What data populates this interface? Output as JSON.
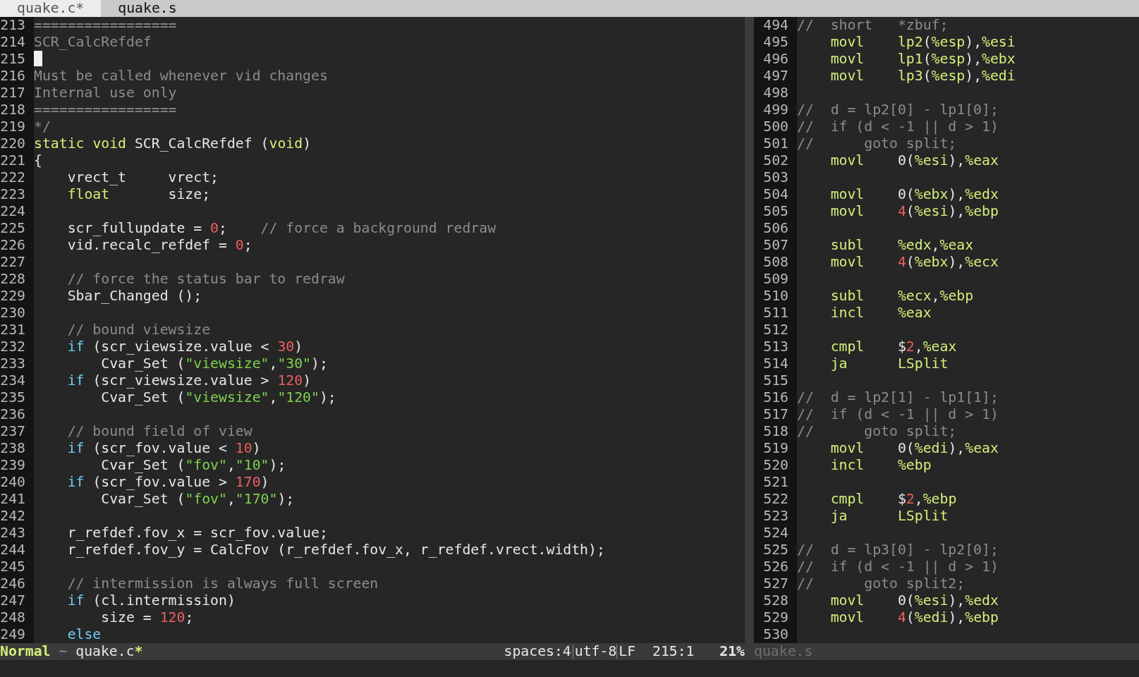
{
  "tabs": [
    {
      "label": "quake.c*",
      "selected": true
    },
    {
      "label": "quake.s",
      "selected": false
    }
  ],
  "panes": [
    {
      "lines": [
        {
          "number": "213",
          "cursor": false,
          "tokens": [
            {
              "kind": "comment",
              "text": "================="
            }
          ]
        },
        {
          "number": "214",
          "cursor": false,
          "tokens": [
            {
              "kind": "comment",
              "text": "SCR_CalcRefdef"
            }
          ]
        },
        {
          "number": "215",
          "cursor": true
        },
        {
          "number": "216",
          "cursor": false,
          "tokens": [
            {
              "kind": "comment",
              "text": "Must be called whenever vid changes"
            }
          ]
        },
        {
          "number": "217",
          "cursor": false,
          "tokens": [
            {
              "kind": "comment",
              "text": "Internal use only"
            }
          ]
        },
        {
          "number": "218",
          "cursor": false,
          "tokens": [
            {
              "kind": "comment",
              "text": "================="
            }
          ]
        },
        {
          "number": "219",
          "cursor": false,
          "tokens": [
            {
              "kind": "comment",
              "text": "*/"
            }
          ]
        },
        {
          "number": "220",
          "cursor": false,
          "tokens": [
            {
              "kind": "type",
              "text": "static"
            },
            {
              "kind": "type",
              "text": " void"
            },
            {
              "kind": "plain",
              "text": " SCR_CalcRefdef ("
            },
            {
              "kind": "type",
              "text": "void"
            },
            {
              "kind": "plain",
              "text": ")"
            }
          ]
        },
        {
          "number": "221",
          "cursor": false,
          "tokens": [
            {
              "kind": "plain",
              "text": "{"
            }
          ]
        },
        {
          "number": "222",
          "cursor": false,
          "tokens": [
            {
              "kind": "plain",
              "text": "    vrect_t     vrect;"
            }
          ]
        },
        {
          "number": "223",
          "cursor": false,
          "tokens": [
            {
              "kind": "type",
              "text": "    float"
            },
            {
              "kind": "plain",
              "text": "       size;"
            }
          ]
        },
        {
          "number": "224",
          "cursor": false
        },
        {
          "number": "225",
          "cursor": false,
          "tokens": [
            {
              "kind": "plain",
              "text": "    scr_fullupdate = "
            },
            {
              "kind": "number",
              "text": "0"
            },
            {
              "kind": "plain",
              "text": ";"
            },
            {
              "kind": "comment",
              "text": "    // force a background redraw"
            }
          ]
        },
        {
          "number": "226",
          "cursor": false,
          "tokens": [
            {
              "kind": "plain",
              "text": "    vid.recalc_refdef = "
            },
            {
              "kind": "number",
              "text": "0"
            },
            {
              "kind": "plain",
              "text": ";"
            }
          ]
        },
        {
          "number": "227",
          "cursor": false
        },
        {
          "number": "228",
          "cursor": false,
          "tokens": [
            {
              "kind": "comment",
              "text": "    // force the status bar to redraw"
            }
          ]
        },
        {
          "number": "229",
          "cursor": false,
          "tokens": [
            {
              "kind": "plain",
              "text": "    Sbar_Changed ();"
            }
          ]
        },
        {
          "number": "230",
          "cursor": false
        },
        {
          "number": "231",
          "cursor": false,
          "tokens": [
            {
              "kind": "comment",
              "text": "    // bound viewsize"
            }
          ]
        },
        {
          "number": "232",
          "cursor": false,
          "tokens": [
            {
              "kind": "keyword",
              "text": "    if"
            },
            {
              "kind": "plain",
              "text": " (scr_viewsize.value < "
            },
            {
              "kind": "number",
              "text": "30"
            },
            {
              "kind": "plain",
              "text": ")"
            }
          ]
        },
        {
          "number": "233",
          "cursor": false,
          "tokens": [
            {
              "kind": "plain",
              "text": "        Cvar_Set ("
            },
            {
              "kind": "string",
              "text": "\"viewsize\""
            },
            {
              "kind": "plain",
              "text": ","
            },
            {
              "kind": "string",
              "text": "\"30\""
            },
            {
              "kind": "plain",
              "text": ");"
            }
          ]
        },
        {
          "number": "234",
          "cursor": false,
          "tokens": [
            {
              "kind": "keyword",
              "text": "    if"
            },
            {
              "kind": "plain",
              "text": " (scr_viewsize.value > "
            },
            {
              "kind": "number",
              "text": "120"
            },
            {
              "kind": "plain",
              "text": ")"
            }
          ]
        },
        {
          "number": "235",
          "cursor": false,
          "tokens": [
            {
              "kind": "plain",
              "text": "        Cvar_Set ("
            },
            {
              "kind": "string",
              "text": "\"viewsize\""
            },
            {
              "kind": "plain",
              "text": ","
            },
            {
              "kind": "string",
              "text": "\"120\""
            },
            {
              "kind": "plain",
              "text": ");"
            }
          ]
        },
        {
          "number": "236",
          "cursor": false
        },
        {
          "number": "237",
          "cursor": false,
          "tokens": [
            {
              "kind": "comment",
              "text": "    // bound field of view"
            }
          ]
        },
        {
          "number": "238",
          "cursor": false,
          "tokens": [
            {
              "kind": "keyword",
              "text": "    if"
            },
            {
              "kind": "plain",
              "text": " (scr_fov.value < "
            },
            {
              "kind": "number",
              "text": "10"
            },
            {
              "kind": "plain",
              "text": ")"
            }
          ]
        },
        {
          "number": "239",
          "cursor": false,
          "tokens": [
            {
              "kind": "plain",
              "text": "        Cvar_Set ("
            },
            {
              "kind": "string",
              "text": "\"fov\""
            },
            {
              "kind": "plain",
              "text": ","
            },
            {
              "kind": "string",
              "text": "\"10\""
            },
            {
              "kind": "plain",
              "text": ");"
            }
          ]
        },
        {
          "number": "240",
          "cursor": false,
          "tokens": [
            {
              "kind": "keyword",
              "text": "    if"
            },
            {
              "kind": "plain",
              "text": " (scr_fov.value > "
            },
            {
              "kind": "number",
              "text": "170"
            },
            {
              "kind": "plain",
              "text": ")"
            }
          ]
        },
        {
          "number": "241",
          "cursor": false,
          "tokens": [
            {
              "kind": "plain",
              "text": "        Cvar_Set ("
            },
            {
              "kind": "string",
              "text": "\"fov\""
            },
            {
              "kind": "plain",
              "text": ","
            },
            {
              "kind": "string",
              "text": "\"170\""
            },
            {
              "kind": "plain",
              "text": ");"
            }
          ]
        },
        {
          "number": "242",
          "cursor": false
        },
        {
          "number": "243",
          "cursor": false,
          "tokens": [
            {
              "kind": "plain",
              "text": "    r_refdef.fov_x = scr_fov.value;"
            }
          ]
        },
        {
          "number": "244",
          "cursor": false,
          "tokens": [
            {
              "kind": "plain",
              "text": "    r_refdef.fov_y = CalcFov (r_refdef.fov_x, r_refdef.vrect.width);"
            }
          ]
        },
        {
          "number": "245",
          "cursor": false
        },
        {
          "number": "246",
          "cursor": false,
          "tokens": [
            {
              "kind": "comment",
              "text": "    // intermission is always full screen"
            }
          ]
        },
        {
          "number": "247",
          "cursor": false,
          "tokens": [
            {
              "kind": "keyword",
              "text": "    if"
            },
            {
              "kind": "plain",
              "text": " (cl.intermission)"
            }
          ]
        },
        {
          "number": "248",
          "cursor": false,
          "tokens": [
            {
              "kind": "plain",
              "text": "        size = "
            },
            {
              "kind": "number",
              "text": "120"
            },
            {
              "kind": "plain",
              "text": ";"
            }
          ]
        },
        {
          "number": "249",
          "cursor": false,
          "tokens": [
            {
              "kind": "keyword",
              "text": "    else"
            }
          ]
        }
      ]
    },
    {
      "lines": [
        {
          "number": "494",
          "cursor": false,
          "tokens": [
            {
              "kind": "comment",
              "text": "//  short   *zbuf;"
            }
          ]
        },
        {
          "number": "495",
          "cursor": false,
          "tokens": [
            {
              "kind": "type",
              "text": "    movl"
            },
            {
              "kind": "type",
              "text": "    lp2"
            },
            {
              "kind": "plain",
              "text": "("
            },
            {
              "kind": "type",
              "text": "%esp"
            },
            {
              "kind": "plain",
              "text": "),"
            },
            {
              "kind": "type",
              "text": "%esi"
            }
          ]
        },
        {
          "number": "496",
          "cursor": false,
          "tokens": [
            {
              "kind": "type",
              "text": "    movl"
            },
            {
              "kind": "type",
              "text": "    lp1"
            },
            {
              "kind": "plain",
              "text": "("
            },
            {
              "kind": "type",
              "text": "%esp"
            },
            {
              "kind": "plain",
              "text": "),"
            },
            {
              "kind": "type",
              "text": "%ebx"
            }
          ]
        },
        {
          "number": "497",
          "cursor": false,
          "tokens": [
            {
              "kind": "type",
              "text": "    movl"
            },
            {
              "kind": "type",
              "text": "    lp3"
            },
            {
              "kind": "plain",
              "text": "("
            },
            {
              "kind": "type",
              "text": "%esp"
            },
            {
              "kind": "plain",
              "text": "),"
            },
            {
              "kind": "type",
              "text": "%edi"
            }
          ]
        },
        {
          "number": "498",
          "cursor": false
        },
        {
          "number": "499",
          "cursor": false,
          "tokens": [
            {
              "kind": "comment",
              "text": "//  d = lp2[0] - lp1[0];"
            }
          ]
        },
        {
          "number": "500",
          "cursor": false,
          "tokens": [
            {
              "kind": "comment",
              "text": "//  if (d < -1 || d > 1)"
            }
          ]
        },
        {
          "number": "501",
          "cursor": false,
          "tokens": [
            {
              "kind": "comment",
              "text": "//      goto split;"
            }
          ]
        },
        {
          "number": "502",
          "cursor": false,
          "tokens": [
            {
              "kind": "type",
              "text": "    movl"
            },
            {
              "kind": "plain",
              "text": "    0("
            },
            {
              "kind": "type",
              "text": "%esi"
            },
            {
              "kind": "plain",
              "text": "),"
            },
            {
              "kind": "type",
              "text": "%eax"
            }
          ]
        },
        {
          "number": "503",
          "cursor": false
        },
        {
          "number": "504",
          "cursor": false,
          "tokens": [
            {
              "kind": "type",
              "text": "    movl"
            },
            {
              "kind": "plain",
              "text": "    0("
            },
            {
              "kind": "type",
              "text": "%ebx"
            },
            {
              "kind": "plain",
              "text": "),"
            },
            {
              "kind": "type",
              "text": "%edx"
            }
          ]
        },
        {
          "number": "505",
          "cursor": false,
          "tokens": [
            {
              "kind": "type",
              "text": "    movl"
            },
            {
              "kind": "number",
              "text": "    4"
            },
            {
              "kind": "plain",
              "text": "("
            },
            {
              "kind": "type",
              "text": "%esi"
            },
            {
              "kind": "plain",
              "text": "),"
            },
            {
              "kind": "type",
              "text": "%ebp"
            }
          ]
        },
        {
          "number": "506",
          "cursor": false
        },
        {
          "number": "507",
          "cursor": false,
          "tokens": [
            {
              "kind": "type",
              "text": "    subl"
            },
            {
              "kind": "type",
              "text": "    %edx"
            },
            {
              "kind": "plain",
              "text": ","
            },
            {
              "kind": "type",
              "text": "%eax"
            }
          ]
        },
        {
          "number": "508",
          "cursor": false,
          "tokens": [
            {
              "kind": "type",
              "text": "    movl"
            },
            {
              "kind": "number",
              "text": "    4"
            },
            {
              "kind": "plain",
              "text": "("
            },
            {
              "kind": "type",
              "text": "%ebx"
            },
            {
              "kind": "plain",
              "text": "),"
            },
            {
              "kind": "type",
              "text": "%ecx"
            }
          ]
        },
        {
          "number": "509",
          "cursor": false
        },
        {
          "number": "510",
          "cursor": false,
          "tokens": [
            {
              "kind": "type",
              "text": "    subl"
            },
            {
              "kind": "type",
              "text": "    %ecx"
            },
            {
              "kind": "plain",
              "text": ","
            },
            {
              "kind": "type",
              "text": "%ebp"
            }
          ]
        },
        {
          "number": "511",
          "cursor": false,
          "tokens": [
            {
              "kind": "type",
              "text": "    incl"
            },
            {
              "kind": "type",
              "text": "    %eax"
            }
          ]
        },
        {
          "number": "512",
          "cursor": false
        },
        {
          "number": "513",
          "cursor": false,
          "tokens": [
            {
              "kind": "type",
              "text": "    cmpl"
            },
            {
              "kind": "plain",
              "text": "    $"
            },
            {
              "kind": "number",
              "text": "2"
            },
            {
              "kind": "plain",
              "text": ","
            },
            {
              "kind": "type",
              "text": "%eax"
            }
          ]
        },
        {
          "number": "514",
          "cursor": false,
          "tokens": [
            {
              "kind": "type",
              "text": "    ja"
            },
            {
              "kind": "type",
              "text": "      LSplit"
            }
          ]
        },
        {
          "number": "515",
          "cursor": false
        },
        {
          "number": "516",
          "cursor": false,
          "tokens": [
            {
              "kind": "comment",
              "text": "//  d = lp2[1] - lp1[1];"
            }
          ]
        },
        {
          "number": "517",
          "cursor": false,
          "tokens": [
            {
              "kind": "comment",
              "text": "//  if (d < -1 || d > 1)"
            }
          ]
        },
        {
          "number": "518",
          "cursor": false,
          "tokens": [
            {
              "kind": "comment",
              "text": "//      goto split;"
            }
          ]
        },
        {
          "number": "519",
          "cursor": false,
          "tokens": [
            {
              "kind": "type",
              "text": "    movl"
            },
            {
              "kind": "plain",
              "text": "    0("
            },
            {
              "kind": "type",
              "text": "%edi"
            },
            {
              "kind": "plain",
              "text": "),"
            },
            {
              "kind": "type",
              "text": "%eax"
            }
          ]
        },
        {
          "number": "520",
          "cursor": false,
          "tokens": [
            {
              "kind": "type",
              "text": "    incl"
            },
            {
              "kind": "type",
              "text": "    %ebp"
            }
          ]
        },
        {
          "number": "521",
          "cursor": false
        },
        {
          "number": "522",
          "cursor": false,
          "tokens": [
            {
              "kind": "type",
              "text": "    cmpl"
            },
            {
              "kind": "plain",
              "text": "    $"
            },
            {
              "kind": "number",
              "text": "2"
            },
            {
              "kind": "plain",
              "text": ","
            },
            {
              "kind": "type",
              "text": "%ebp"
            }
          ]
        },
        {
          "number": "523",
          "cursor": false,
          "tokens": [
            {
              "kind": "type",
              "text": "    ja"
            },
            {
              "kind": "type",
              "text": "      LSplit"
            }
          ]
        },
        {
          "number": "524",
          "cursor": false
        },
        {
          "number": "525",
          "cursor": false,
          "tokens": [
            {
              "kind": "comment",
              "text": "//  d = lp3[0] - lp2[0];"
            }
          ]
        },
        {
          "number": "526",
          "cursor": false,
          "tokens": [
            {
              "kind": "comment",
              "text": "//  if (d < -1 || d > 1)"
            }
          ]
        },
        {
          "number": "527",
          "cursor": false,
          "tokens": [
            {
              "kind": "comment",
              "text": "//      goto split2;"
            }
          ]
        },
        {
          "number": "528",
          "cursor": false,
          "tokens": [
            {
              "kind": "type",
              "text": "    movl"
            },
            {
              "kind": "plain",
              "text": "    0("
            },
            {
              "kind": "type",
              "text": "%esi"
            },
            {
              "kind": "plain",
              "text": "),"
            },
            {
              "kind": "type",
              "text": "%edx"
            }
          ]
        },
        {
          "number": "529",
          "cursor": false,
          "tokens": [
            {
              "kind": "type",
              "text": "    movl"
            },
            {
              "kind": "number",
              "text": "    4"
            },
            {
              "kind": "plain",
              "text": "("
            },
            {
              "kind": "type",
              "text": "%edi"
            },
            {
              "kind": "plain",
              "text": "),"
            },
            {
              "kind": "type",
              "text": "%ebp"
            }
          ]
        },
        {
          "number": "530",
          "cursor": false
        }
      ]
    }
  ],
  "status_bar": {
    "mode": "Normal",
    "separator": "~",
    "file": "quake.c",
    "modified": "*",
    "indent": "spaces:4",
    "encoding": "utf-8",
    "line_ending": "LF",
    "position": "215:1",
    "percent": "21%",
    "second_file": "quake.s"
  }
}
